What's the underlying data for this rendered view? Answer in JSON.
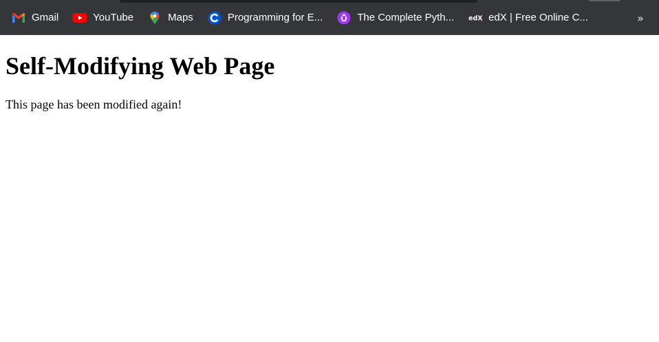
{
  "colors": {
    "bookmarks_bar_bg": "#35363a",
    "bookmark_text": "#ffffff",
    "page_bg": "#ffffff",
    "page_text": "#000000"
  },
  "bookmarks": [
    {
      "label": "Gmail",
      "icon": "gmail-icon"
    },
    {
      "label": "YouTube",
      "icon": "youtube-icon"
    },
    {
      "label": "Maps",
      "icon": "maps-icon"
    },
    {
      "label": "Programming for E...",
      "icon": "coursera-icon"
    },
    {
      "label": "The Complete Pyth...",
      "icon": "udemy-icon"
    },
    {
      "label": "edX | Free Online C...",
      "icon": "edx-icon"
    }
  ],
  "bookmarks_overflow": {
    "label": "»",
    "icon": "chevron-double-right-icon"
  },
  "page": {
    "heading": "Self-Modifying Web Page",
    "paragraph": "This page has been modified again!"
  }
}
